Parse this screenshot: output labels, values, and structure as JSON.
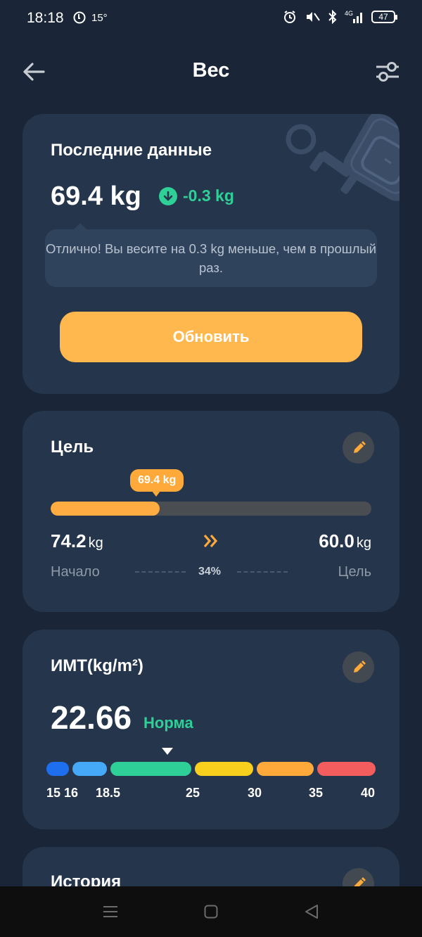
{
  "status_bar": {
    "time": "18:18",
    "temperature": "15°",
    "battery": "47",
    "network": "4G"
  },
  "header": {
    "title": "Вес",
    "back_icon": "arrow-left-icon",
    "filter_icon": "sliders-icon"
  },
  "latest": {
    "title": "Последние данные",
    "weight": "69.4 kg",
    "delta": "-0.3 kg",
    "delta_icon": "arrow-down-circle-icon",
    "tip": "Отлично! Вы весите на 0.3 kg меньше, чем в прошлый раз.",
    "update_button": "Обновить"
  },
  "goal": {
    "title": "Цель",
    "current_badge": "69.4 kg",
    "progress_fraction": 0.34,
    "start_value": "74.2",
    "start_unit": "kg",
    "target_value": "60.0",
    "target_unit": "kg",
    "start_label": "Начало",
    "target_label": "Цель",
    "percent": "34%"
  },
  "bmi": {
    "title": "ИМТ(kg/m²)",
    "value": "22.66",
    "status": "Норма",
    "ticks": [
      "15",
      "16",
      "18.5",
      "25",
      "30",
      "35",
      "40"
    ],
    "segment_colors": [
      "#1e6ff0",
      "#46a9f7",
      "#2fcf98",
      "#f8cf1c",
      "#ffa93a",
      "#f35d5d"
    ]
  },
  "history": {
    "title": "История"
  },
  "colors": {
    "background": "#1a2637",
    "card": "#25354b",
    "accent": "#ffb84e",
    "positive": "#2fcf98"
  }
}
